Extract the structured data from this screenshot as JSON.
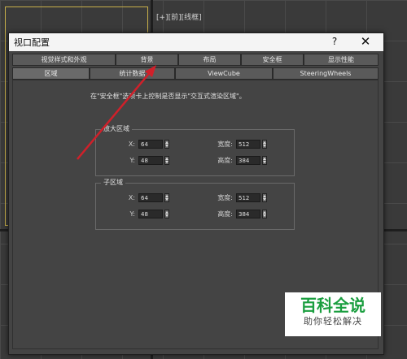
{
  "viewport": {
    "label_left": "[+][前][线框]",
    "label_right": ""
  },
  "dialog": {
    "title": "视口配置",
    "help": "?",
    "close": "✕"
  },
  "tabs_row1": [
    {
      "label": "视觉样式和外观"
    },
    {
      "label": "背景"
    },
    {
      "label": "布局"
    },
    {
      "label": "安全框"
    },
    {
      "label": "显示性能"
    }
  ],
  "tabs_row2": [
    {
      "label": "区域"
    },
    {
      "label": "统计数据"
    },
    {
      "label": "ViewCube"
    },
    {
      "label": "SteeringWheels"
    }
  ],
  "panel": {
    "description": "在\"安全框\"选项卡上控制是否显示\"交互式渲染区域\"。"
  },
  "zoom_region": {
    "title": "放大区域",
    "x_label": "X:",
    "x_value": "64",
    "y_label": "Y:",
    "y_value": "48",
    "width_label": "宽度:",
    "width_value": "512",
    "height_label": "高度:",
    "height_value": "384"
  },
  "sub_region": {
    "title": "子区域",
    "x_label": "X:",
    "x_value": "64",
    "y_label": "Y:",
    "y_value": "48",
    "width_label": "宽度:",
    "width_value": "512",
    "height_label": "高度:",
    "height_value": "384"
  },
  "watermark": {
    "main": "百科全说",
    "sub": "助你轻松解决"
  },
  "colors": {
    "annotation_arrow": "#d0202a",
    "watermark_green": "#1a9e3f"
  }
}
